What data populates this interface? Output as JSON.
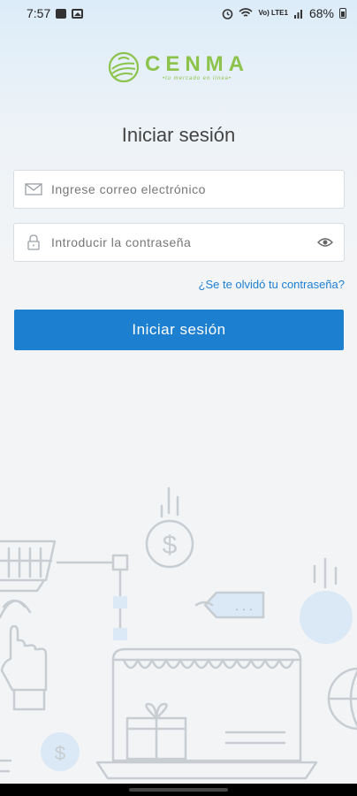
{
  "status_bar": {
    "time": "7:57",
    "network": "Vo) LTE1",
    "battery": "68%"
  },
  "logo": {
    "name": "CENMA",
    "tagline": "•tu mercado en línea•"
  },
  "title": "Iniciar sesión",
  "email": {
    "placeholder": "Ingrese correo electrónico",
    "icon": "envelope-icon"
  },
  "password": {
    "placeholder": "Introducir la contraseña",
    "icon": "lock-icon",
    "toggle_icon": "eye-icon"
  },
  "forgot_link": "¿Se te olvidó tu contraseña?",
  "login_button": "Iniciar sesión",
  "illustration": {
    "label": "$",
    "dots": ". . ."
  },
  "colors": {
    "brand_green": "#8cc34a",
    "primary_blue": "#1d7fd0",
    "link_blue": "#1e7fd1"
  }
}
